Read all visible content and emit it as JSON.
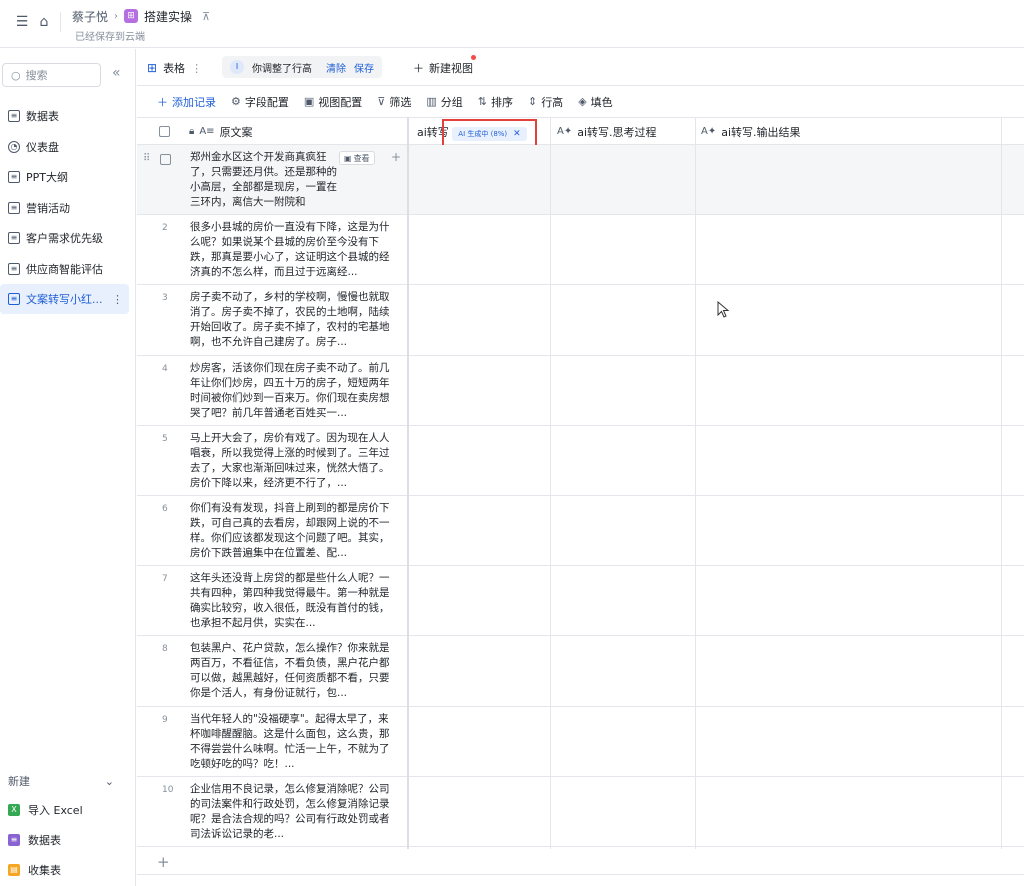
{
  "topbar": {
    "breadcrumb_parent": "蔡子悦",
    "app_badge": "⊞",
    "breadcrumb_current": "搭建实操",
    "saved_status": "已经保存到云端"
  },
  "sidebar": {
    "search_placeholder": "搜索",
    "items": [
      {
        "label": "数据表",
        "icon": "table-icon"
      },
      {
        "label": "仪表盘",
        "icon": "dashboard-icon"
      },
      {
        "label": "PPT大纲",
        "icon": "table-icon"
      },
      {
        "label": "营销活动",
        "icon": "table-icon"
      },
      {
        "label": "客户需求优先级",
        "icon": "table-icon"
      },
      {
        "label": "供应商智能评估",
        "icon": "table-icon"
      },
      {
        "label": "文案转写小红...",
        "icon": "table-icon",
        "active": true
      }
    ],
    "new_section": {
      "title": "新建",
      "items": [
        {
          "label": "导入 Excel",
          "color": "#34a853",
          "icon": "excel-icon"
        },
        {
          "label": "数据表",
          "color": "#8a63d2",
          "icon": "table-icon"
        },
        {
          "label": "收集表",
          "color": "#f5a623",
          "icon": "form-icon"
        }
      ]
    }
  },
  "viewbar": {
    "view_name": "表格",
    "pill_text": "你调整了行高",
    "clear_label": "清除",
    "save_label": "保存",
    "new_view_label": "新建视图"
  },
  "toolbar": {
    "add_record": "添加记录",
    "field_config": "字段配置",
    "view_config": "视图配置",
    "filter": "筛选",
    "group": "分组",
    "sort": "排序",
    "row_height": "行高",
    "fill_color": "填色"
  },
  "columns": {
    "col1": "原文案",
    "col2": "ai转写",
    "col2_tag": "AI 生成中 (8%)",
    "col3": "ai转写.思考过程",
    "col4": "ai转写.输出结果"
  },
  "row_view_btn": "查看",
  "rows": [
    {
      "num": "1",
      "text": "郑州金水区这个开发商真疯狂了，只需要还月供。还是那种的小高层，全部都是现房，一置在三环内，离信大一附院和"
    },
    {
      "num": "2",
      "text": "很多小县城的房价一直没有下降，这是为什么呢？如果说某个县城的房价至今没有下跌，那真是要小心了，这证明这个县城的经济真的不怎么样，而且过于远离经..."
    },
    {
      "num": "3",
      "text": "房子卖不动了，乡村的学校啊，慢慢也就取消了。房子卖不掉了，农民的土地啊，陆续开始回收了。房子卖不掉了，农村的宅基地啊，也不允许自己建房了。房子..."
    },
    {
      "num": "4",
      "text": "炒房客，活该你们现在房子卖不动了。前几年让你们炒房，四五十万的房子，短短两年时间被你们炒到一百来万。你们现在卖房想哭了吧？前几年普通老百姓买一..."
    },
    {
      "num": "5",
      "text": "马上开大会了，房价有戏了。因为现在人人唱衰，所以我觉得上涨的时候到了。三年过去了，大家也渐渐回味过来，恍然大悟了。房价下降以来，经济更不行了，..."
    },
    {
      "num": "6",
      "text": " 你们有没有发现，抖音上刷到的都是房价下跌，可自己真的去看房，却跟网上说的不一样。你们应该都发现这个问题了吧。其实，房价下跌普遍集中在位置差、配..."
    },
    {
      "num": "7",
      "text": "这年头还没背上房贷的都是些什么人呢？一共有四种，第四种我觉得最牛。第一种就是确实比较穷，收入很低，既没有首付的钱，也承担不起月供，实实在..."
    },
    {
      "num": "8",
      "text": "包装黑户、花户贷款，怎么操作？你来就是两百万，不看征信，不看负债，黑户花户都可以做，越黑越好，任何资质都不看，只要你是个活人，有身份证就行，包..."
    },
    {
      "num": "9",
      "text": " 当代年轻人的\"没福硬享\"。起得太早了，来杯咖啡醒醒脑。这是什么面包，这么贵，那不得尝尝什么味啊。忙活一上午，不就为了吃顿好吃的吗？吃！..."
    },
    {
      "num": "10",
      "text": "企业信用不良记录，怎么修复消除呢？公司的司法案件和行政处罚，怎么修复消除记录呢？是合法合规的吗？公司有行政处罚或者司法诉讼记录的老..."
    }
  ]
}
